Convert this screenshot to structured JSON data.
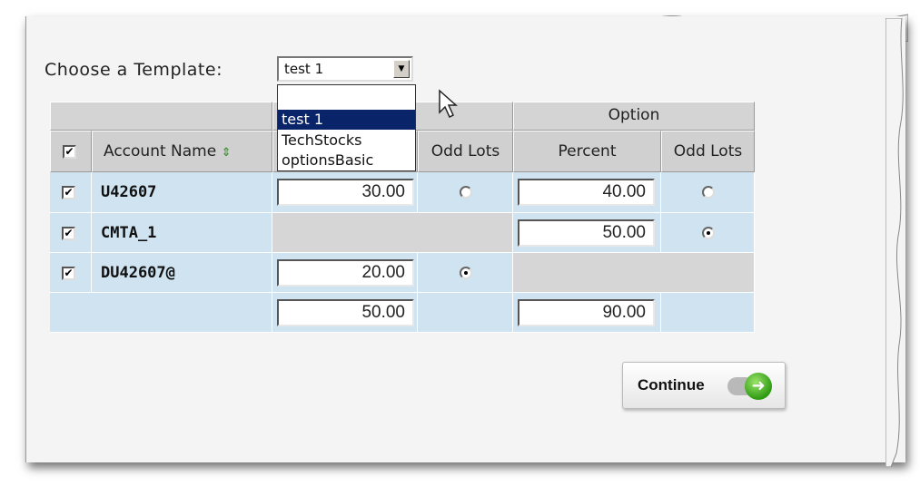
{
  "template": {
    "label": "Choose a Template:",
    "selected": "test 1",
    "options": [
      "",
      "test 1",
      "TechStocks",
      "optionsBasic"
    ]
  },
  "table": {
    "group_headers": [
      "",
      "",
      "Option"
    ],
    "headers": {
      "account_name": "Account Name",
      "odd_lots_1": "Odd Lots",
      "percent": "Percent",
      "odd_lots_2": "Odd Lots"
    },
    "rows": [
      {
        "checked": true,
        "account": "U42607",
        "value1": "30.00",
        "odd1": false,
        "percent": "40.00",
        "odd2": false
      },
      {
        "checked": true,
        "account": "CMTA_1",
        "value1": "",
        "odd1": null,
        "percent": "50.00",
        "odd2": true
      },
      {
        "checked": true,
        "account": "DU42607@",
        "value1": "20.00",
        "odd1": true,
        "percent": "",
        "odd2": null
      }
    ],
    "totals": {
      "value1": "50.00",
      "percent": "90.00"
    }
  },
  "continue_button": {
    "label": "Continue",
    "icon": "arrow-right-icon"
  },
  "colors": {
    "row_bg": "#cfe3f0",
    "header_bg": "#d4d4d4",
    "selected_option": "#0a246a",
    "arrow_green": "#2f9b12"
  }
}
